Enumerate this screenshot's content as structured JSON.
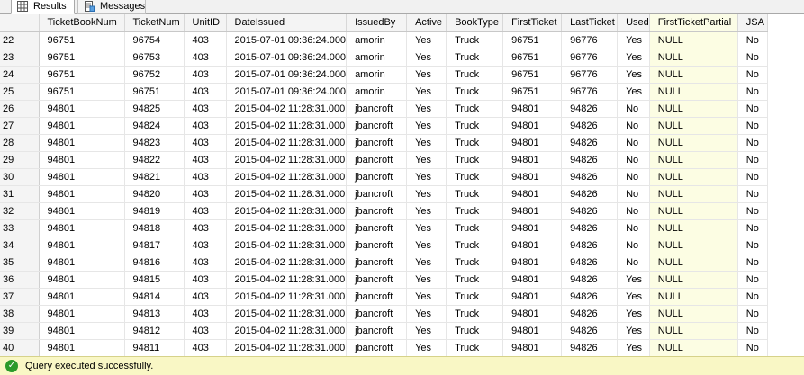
{
  "tabs": [
    {
      "label": "Results"
    },
    {
      "label": "Messages"
    }
  ],
  "columns": [
    "",
    "TicketBookNum",
    "TicketNum",
    "UnitID",
    "DateIssued",
    "IssuedBy",
    "Active",
    "BookType",
    "FirstTicket",
    "LastTicket",
    "Used",
    "FirstTicketPartial",
    "JSA"
  ],
  "rows": [
    [
      "22",
      "96751",
      "96754",
      "403",
      "2015-07-01 09:36:24.000",
      "amorin",
      "Yes",
      "Truck",
      "96751",
      "96776",
      "Yes",
      "NULL",
      "No"
    ],
    [
      "23",
      "96751",
      "96753",
      "403",
      "2015-07-01 09:36:24.000",
      "amorin",
      "Yes",
      "Truck",
      "96751",
      "96776",
      "Yes",
      "NULL",
      "No"
    ],
    [
      "24",
      "96751",
      "96752",
      "403",
      "2015-07-01 09:36:24.000",
      "amorin",
      "Yes",
      "Truck",
      "96751",
      "96776",
      "Yes",
      "NULL",
      "No"
    ],
    [
      "25",
      "96751",
      "96751",
      "403",
      "2015-07-01 09:36:24.000",
      "amorin",
      "Yes",
      "Truck",
      "96751",
      "96776",
      "Yes",
      "NULL",
      "No"
    ],
    [
      "26",
      "94801",
      "94825",
      "403",
      "2015-04-02 11:28:31.000",
      "jbancroft",
      "Yes",
      "Truck",
      "94801",
      "94826",
      "No",
      "NULL",
      "No"
    ],
    [
      "27",
      "94801",
      "94824",
      "403",
      "2015-04-02 11:28:31.000",
      "jbancroft",
      "Yes",
      "Truck",
      "94801",
      "94826",
      "No",
      "NULL",
      "No"
    ],
    [
      "28",
      "94801",
      "94823",
      "403",
      "2015-04-02 11:28:31.000",
      "jbancroft",
      "Yes",
      "Truck",
      "94801",
      "94826",
      "No",
      "NULL",
      "No"
    ],
    [
      "29",
      "94801",
      "94822",
      "403",
      "2015-04-02 11:28:31.000",
      "jbancroft",
      "Yes",
      "Truck",
      "94801",
      "94826",
      "No",
      "NULL",
      "No"
    ],
    [
      "30",
      "94801",
      "94821",
      "403",
      "2015-04-02 11:28:31.000",
      "jbancroft",
      "Yes",
      "Truck",
      "94801",
      "94826",
      "No",
      "NULL",
      "No"
    ],
    [
      "31",
      "94801",
      "94820",
      "403",
      "2015-04-02 11:28:31.000",
      "jbancroft",
      "Yes",
      "Truck",
      "94801",
      "94826",
      "No",
      "NULL",
      "No"
    ],
    [
      "32",
      "94801",
      "94819",
      "403",
      "2015-04-02 11:28:31.000",
      "jbancroft",
      "Yes",
      "Truck",
      "94801",
      "94826",
      "No",
      "NULL",
      "No"
    ],
    [
      "33",
      "94801",
      "94818",
      "403",
      "2015-04-02 11:28:31.000",
      "jbancroft",
      "Yes",
      "Truck",
      "94801",
      "94826",
      "No",
      "NULL",
      "No"
    ],
    [
      "34",
      "94801",
      "94817",
      "403",
      "2015-04-02 11:28:31.000",
      "jbancroft",
      "Yes",
      "Truck",
      "94801",
      "94826",
      "No",
      "NULL",
      "No"
    ],
    [
      "35",
      "94801",
      "94816",
      "403",
      "2015-04-02 11:28:31.000",
      "jbancroft",
      "Yes",
      "Truck",
      "94801",
      "94826",
      "No",
      "NULL",
      "No"
    ],
    [
      "36",
      "94801",
      "94815",
      "403",
      "2015-04-02 11:28:31.000",
      "jbancroft",
      "Yes",
      "Truck",
      "94801",
      "94826",
      "Yes",
      "NULL",
      "No"
    ],
    [
      "37",
      "94801",
      "94814",
      "403",
      "2015-04-02 11:28:31.000",
      "jbancroft",
      "Yes",
      "Truck",
      "94801",
      "94826",
      "Yes",
      "NULL",
      "No"
    ],
    [
      "38",
      "94801",
      "94813",
      "403",
      "2015-04-02 11:28:31.000",
      "jbancroft",
      "Yes",
      "Truck",
      "94801",
      "94826",
      "Yes",
      "NULL",
      "No"
    ],
    [
      "39",
      "94801",
      "94812",
      "403",
      "2015-04-02 11:28:31.000",
      "jbancroft",
      "Yes",
      "Truck",
      "94801",
      "94826",
      "Yes",
      "NULL",
      "No"
    ],
    [
      "40",
      "94801",
      "94811",
      "403",
      "2015-04-02 11:28:31.000",
      "jbancroft",
      "Yes",
      "Truck",
      "94801",
      "94826",
      "Yes",
      "NULL",
      "No"
    ]
  ],
  "status": {
    "text": "Query executed successfully.",
    "icon": "check-icon",
    "color": "#f9f7c5"
  },
  "colors": {
    "null_highlight": "#fcfde3",
    "header_bg": "#f4f4f4"
  }
}
